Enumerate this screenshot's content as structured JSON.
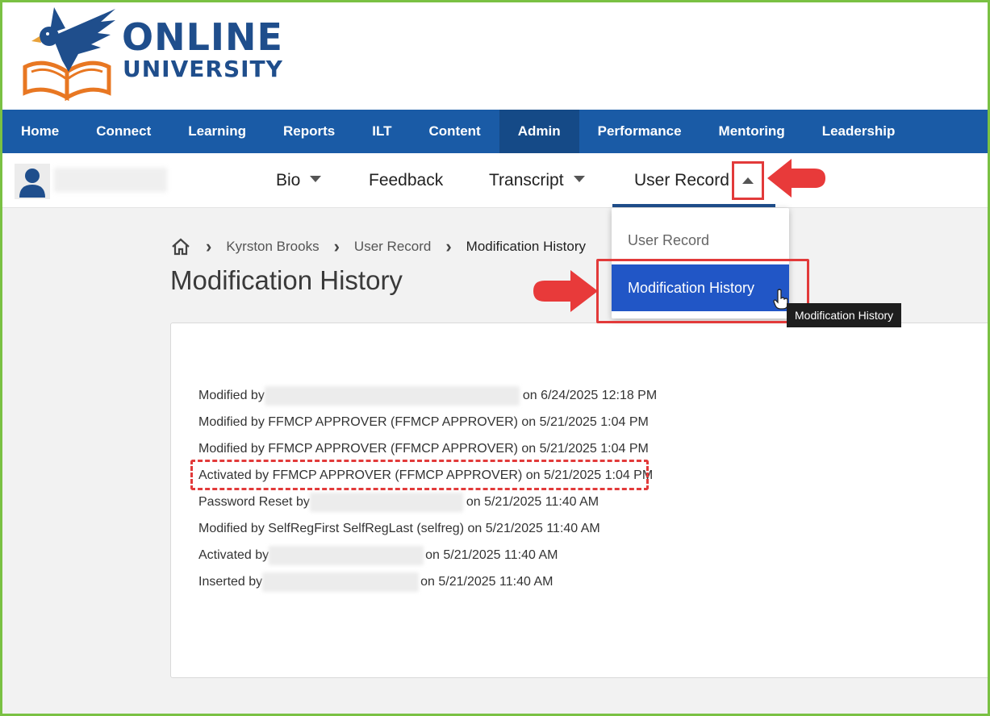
{
  "brand": {
    "line1": "ONLINE",
    "line2": "UNIVERSITY",
    "colors": {
      "primary": "#1f4e8c",
      "accent": "#e87722"
    }
  },
  "nav": {
    "items": [
      {
        "label": "Home"
      },
      {
        "label": "Connect"
      },
      {
        "label": "Learning"
      },
      {
        "label": "Reports"
      },
      {
        "label": "ILT"
      },
      {
        "label": "Content"
      },
      {
        "label": "Admin",
        "active": true
      },
      {
        "label": "Performance"
      },
      {
        "label": "Mentoring"
      },
      {
        "label": "Leadership"
      }
    ]
  },
  "subnav": {
    "bio": "Bio",
    "feedback": "Feedback",
    "transcript": "Transcript",
    "user_record": "User Record"
  },
  "dropdown": {
    "items": [
      "User Record",
      "Modification History"
    ],
    "tooltip": "Modification History"
  },
  "breadcrumb": {
    "items": [
      "Kyrston Brooks",
      "User Record",
      "Modification History"
    ]
  },
  "page": {
    "title": "Modification History"
  },
  "history": [
    {
      "before": "Modified by",
      "after": "on 6/24/2025 12:18 PM"
    },
    {
      "text": "Modified by FFMCP APPROVER (FFMCP APPROVER) on 5/21/2025 1:04 PM"
    },
    {
      "text": "Modified by FFMCP APPROVER (FFMCP APPROVER) on 5/21/2025 1:04 PM"
    },
    {
      "text": "Activated by FFMCP APPROVER (FFMCP APPROVER) on 5/21/2025 1:04 PM",
      "highlighted": true
    },
    {
      "before": "Password Reset by",
      "after": "on 5/21/2025 11:40 AM"
    },
    {
      "text": "Modified by SelfRegFirst SelfRegLast (selfreg) on 5/21/2025 11:40 AM"
    },
    {
      "before": "Activated by",
      "after": "on 5/21/2025 11:40 AM"
    },
    {
      "before": "Inserted by",
      "after": "on 5/21/2025 11:40 AM"
    }
  ],
  "annotation_color": "#e23a3a"
}
